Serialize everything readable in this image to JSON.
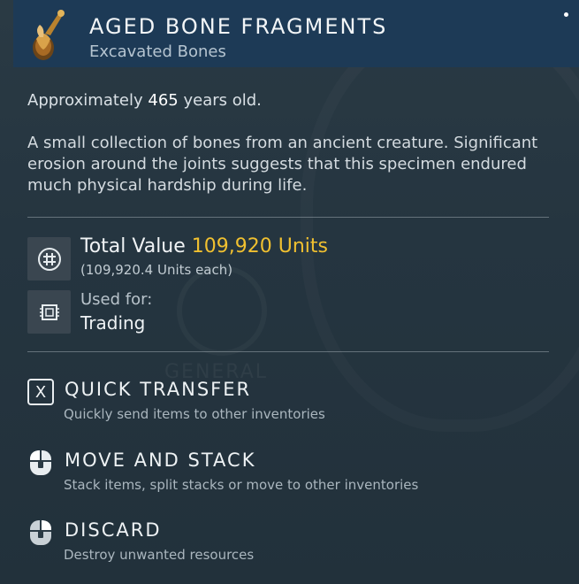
{
  "item": {
    "name": "AGED BONE FRAGMENTS",
    "category": "Excavated Bones",
    "icon": "bone-fragments-icon"
  },
  "age": {
    "prefix": "Approximately",
    "value": "465",
    "suffix": "years old."
  },
  "description": "A small collection of bones from an ancient creature. Significant erosion around the joints suggests that this specimen endured much physical hardship during life.",
  "value": {
    "label": "Total Value",
    "amount": "109,920 Units",
    "each": "(109,920.4 Units each)",
    "icon": "units-currency-icon"
  },
  "usage": {
    "label": "Used for:",
    "value": "Trading",
    "icon": "trade-chip-icon"
  },
  "background_text": "GENERAL",
  "actions": [
    {
      "key": "X",
      "title": "QUICK TRANSFER",
      "subtitle": "Quickly send items to other inventories",
      "icon": "x-key-icon"
    },
    {
      "key": "",
      "title": "MOVE AND STACK",
      "subtitle": "Stack items, split stacks or move to other inventories",
      "icon": "mouse-left-click-icon"
    },
    {
      "key": "",
      "title": "DISCARD",
      "subtitle": "Destroy unwanted resources",
      "icon": "mouse-right-click-icon"
    }
  ],
  "colors": {
    "header_bg": "#1d3a56",
    "panel_bg": "#253540",
    "value_accent": "#f0c030"
  }
}
